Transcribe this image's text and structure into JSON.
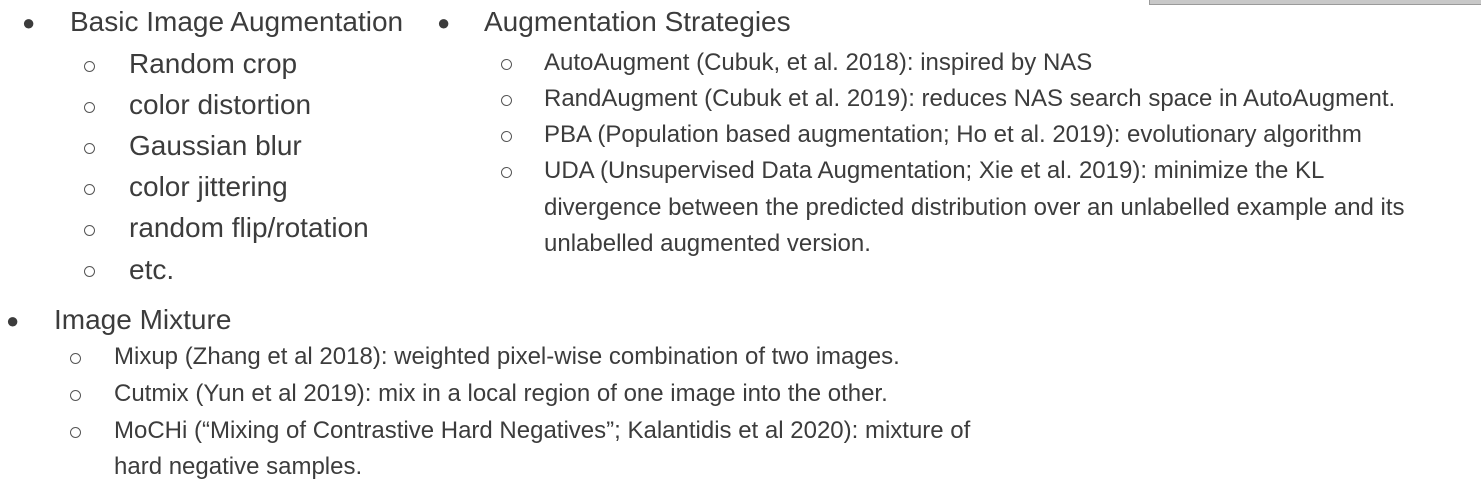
{
  "basic": {
    "heading": "Basic Image Augmentation",
    "items": [
      "Random crop",
      "color distortion",
      "Gaussian blur",
      "color jittering",
      "random flip/rotation",
      "etc."
    ]
  },
  "strategies": {
    "heading": "Augmentation Strategies",
    "items": [
      "AutoAugment (Cubuk, et al. 2018): inspired by NAS",
      "RandAugment (Cubuk et al. 2019): reduces NAS search space in AutoAugment.",
      "PBA (Population based augmentation; Ho et al. 2019): evolutionary algorithm",
      "UDA (Unsupervised Data Augmentation; Xie et al. 2019): minimize the KL",
      "divergence between the predicted distribution over an unlabelled example and its",
      "unlabelled augmented version."
    ]
  },
  "mixture": {
    "heading": "Image Mixture",
    "items": [
      "Mixup (Zhang et al 2018): weighted pixel-wise combination of two images.",
      "Cutmix (Yun et al 2019): mix in a local region of one image into the other.",
      "MoCHi (“Mixing of Contrastive Hard Negatives”; Kalantidis et al 2020): mixture of",
      "hard negative samples."
    ]
  }
}
